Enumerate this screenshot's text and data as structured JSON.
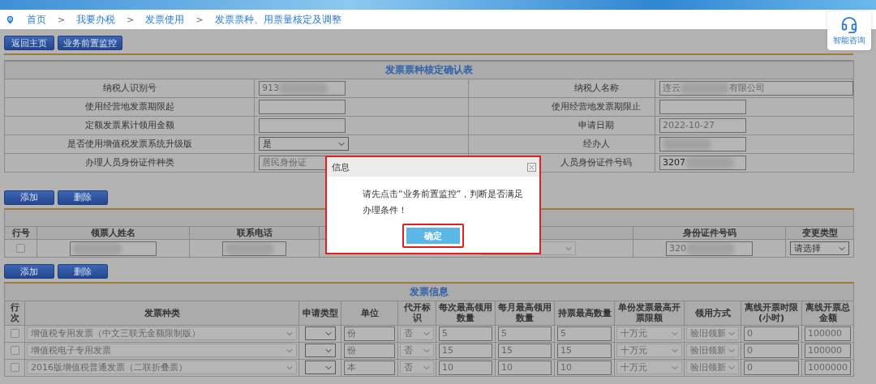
{
  "breadcrumb": {
    "separator": ">",
    "items": [
      "首页",
      "我要办税",
      "发票使用",
      "发票票种、用票量核定及调整"
    ]
  },
  "help_widget": {
    "label": "智能咨询"
  },
  "top_buttons": [
    "返回主页",
    "业务前置监控"
  ],
  "confirm_table": {
    "title": "发票票种核定确认表",
    "fields": [
      {
        "label": "纳税人识别号",
        "kind": "input",
        "value": "913",
        "redacted": true
      },
      {
        "label": "纳税人名称",
        "kind": "wide_input",
        "value": "连云",
        "value_end": "有限公司",
        "redacted": true
      },
      {
        "label": "使用经营地发票期限起",
        "kind": "input"
      },
      {
        "label": "使用经营地发票期限止",
        "kind": "input"
      },
      {
        "label": "定额发票累计领用金额",
        "kind": "input"
      },
      {
        "label": "申请日期",
        "kind": "input",
        "value": "2022-10-27"
      },
      {
        "label": "是否使用增值税发票系统升级版",
        "kind": "select",
        "value": "是"
      },
      {
        "label": "经办人",
        "kind": "input",
        "redacted": true
      },
      {
        "label": "办理人员身份证件种类",
        "kind": "input",
        "value": "居民身份证"
      },
      {
        "label": "人员身份证件号码",
        "kind": "input",
        "value": "3207",
        "redacted": true,
        "dark": true
      }
    ]
  },
  "collector_buttons": [
    "添加",
    "删除"
  ],
  "collector_table": {
    "columns": [
      {
        "label": "行号",
        "kind": "check"
      },
      {
        "label": "领票人姓名",
        "kind": "input"
      },
      {
        "label": "联系电话",
        "kind": "input"
      },
      {
        "kind": "blank_select"
      },
      {
        "label": "身份证件号码",
        "kind": "input"
      },
      {
        "label": "变更类型",
        "kind": "select"
      }
    ],
    "rows": [
      {
        "cells": [
          {
            "checked": false
          },
          {
            "redacted": true
          },
          {
            "redacted": true
          },
          "",
          {
            "value": "320",
            "redacted": true
          },
          {
            "value": "请选择"
          }
        ]
      }
    ]
  },
  "invoice_buttons": [
    "添加",
    "删除"
  ],
  "invoice_table": {
    "title": "发票信息",
    "columns": [
      {
        "label": "行次",
        "kind": "check"
      },
      {
        "label": "发票种类",
        "kind": "select"
      },
      {
        "label": "申请类型",
        "kind": "blank_select"
      },
      {
        "label": "单位",
        "kind": "input"
      },
      {
        "label": "代开标识",
        "kind": "select"
      },
      {
        "label": "每次最高领用数量",
        "kind": "input"
      },
      {
        "label": "每月最高领用数量",
        "kind": "input"
      },
      {
        "label": "持票最高数量",
        "kind": "input"
      },
      {
        "label": "单份发票最高开票限额",
        "kind": "select"
      },
      {
        "label": "领用方式",
        "kind": "select"
      },
      {
        "label": "离线开票时限(小时)",
        "kind": "input"
      },
      {
        "label": "离线开票总金额",
        "kind": "input"
      }
    ],
    "rows": [
      {
        "cells": [
          {
            "checked": false
          },
          {
            "value": "增值税专用发票（中文三联无金额限制版）"
          },
          "",
          {
            "value": "份"
          },
          {
            "value": "否"
          },
          {
            "value": "5"
          },
          {
            "value": "5"
          },
          {
            "value": "5"
          },
          {
            "value": "十万元"
          },
          {
            "value": "验旧领新"
          },
          {
            "value": "0"
          },
          {
            "value": "100000"
          }
        ]
      },
      {
        "cells": [
          {
            "checked": false
          },
          {
            "value": "增值税电子专用发票"
          },
          "",
          {
            "value": "份"
          },
          {
            "value": "否"
          },
          {
            "value": "15"
          },
          {
            "value": "15"
          },
          {
            "value": "15"
          },
          {
            "value": "十万元"
          },
          {
            "value": "验旧领新"
          },
          {
            "value": "0"
          },
          {
            "value": "100000"
          }
        ]
      },
      {
        "cells": [
          {
            "checked": false
          },
          {
            "value": "2016版增值税普通发票（二联折叠票）"
          },
          "",
          {
            "value": "本"
          },
          {
            "value": "否"
          },
          {
            "value": "10"
          },
          {
            "value": "10"
          },
          {
            "value": "10"
          },
          {
            "value": "十万元"
          },
          {
            "value": "验旧领新"
          },
          {
            "value": "0"
          },
          {
            "value": "1000000"
          }
        ]
      }
    ]
  },
  "dialog": {
    "title": "信息",
    "message": "请先点击“业务前置监控”，判断是否满足办理条件！",
    "button": "确定"
  }
}
